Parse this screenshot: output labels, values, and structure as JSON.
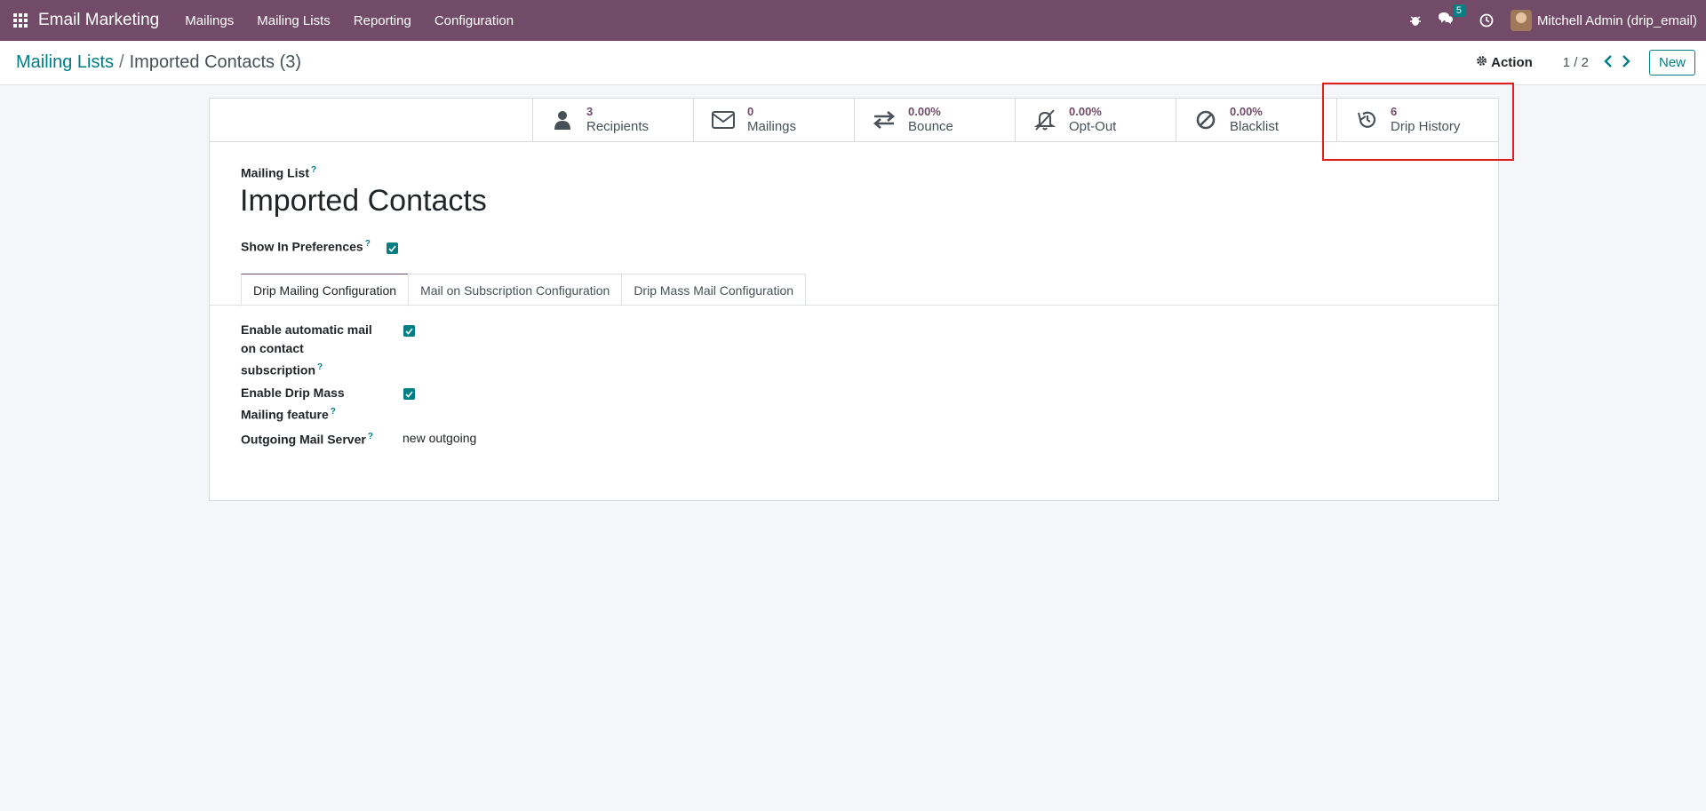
{
  "navbar": {
    "app_name": "Email Marketing",
    "menu": [
      "Mailings",
      "Mailing Lists",
      "Reporting",
      "Configuration"
    ],
    "message_count": "5",
    "user": "Mitchell Admin (drip_email)"
  },
  "control_panel": {
    "breadcrumb_parent": "Mailing Lists",
    "breadcrumb_separator": "/",
    "breadcrumb_current": "Imported Contacts (3)",
    "action_label": "Action",
    "pager": "1 / 2",
    "new_label": "New"
  },
  "stats": [
    {
      "value": "3",
      "label": "Recipients",
      "icon": "user-icon"
    },
    {
      "value": "0",
      "label": "Mailings",
      "icon": "envelope-icon"
    },
    {
      "value": "0.00%",
      "label": "Bounce",
      "icon": "exchange-icon"
    },
    {
      "value": "0.00%",
      "label": "Opt-Out",
      "icon": "bell-slash-icon"
    },
    {
      "value": "0.00%",
      "label": "Blacklist",
      "icon": "ban-icon"
    },
    {
      "value": "6",
      "label": "Drip History",
      "icon": "history-icon"
    }
  ],
  "form": {
    "name_label": "Mailing List",
    "help_mark": "?",
    "name_value": "Imported Contacts",
    "show_in_preferences_label": "Show In Preferences",
    "show_in_preferences_checked": true
  },
  "tabs": [
    "Drip Mailing Configuration",
    "Mail on Subscription Configuration",
    "Drip Mass Mail Configuration"
  ],
  "fields": {
    "auto_mail_label_1": "Enable automatic mail",
    "auto_mail_label_2": "on contact",
    "auto_mail_label_3": "subscription",
    "drip_mass_label_1": "Enable Drip Mass",
    "drip_mass_label_2": "Mailing feature",
    "outgoing_server_label": "Outgoing Mail Server",
    "outgoing_server_value": "new outgoing"
  },
  "colors": {
    "navbar": "#714b67",
    "accent": "#017e84",
    "highlight": "#e11d1d"
  }
}
